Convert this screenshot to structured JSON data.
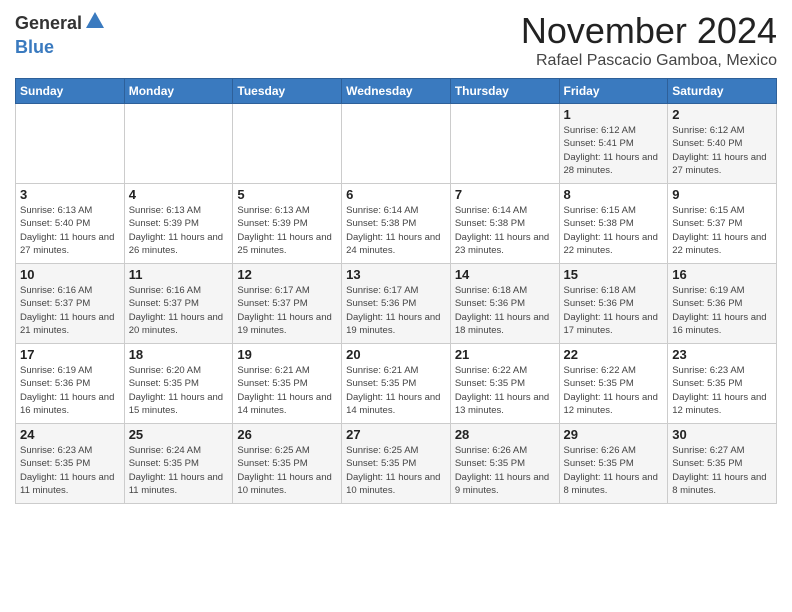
{
  "header": {
    "logo_general": "General",
    "logo_blue": "Blue",
    "month": "November 2024",
    "location": "Rafael Pascacio Gamboa, Mexico"
  },
  "weekdays": [
    "Sunday",
    "Monday",
    "Tuesday",
    "Wednesday",
    "Thursday",
    "Friday",
    "Saturday"
  ],
  "weeks": [
    [
      {
        "day": "",
        "info": ""
      },
      {
        "day": "",
        "info": ""
      },
      {
        "day": "",
        "info": ""
      },
      {
        "day": "",
        "info": ""
      },
      {
        "day": "",
        "info": ""
      },
      {
        "day": "1",
        "info": "Sunrise: 6:12 AM\nSunset: 5:41 PM\nDaylight: 11 hours and 28 minutes."
      },
      {
        "day": "2",
        "info": "Sunrise: 6:12 AM\nSunset: 5:40 PM\nDaylight: 11 hours and 27 minutes."
      }
    ],
    [
      {
        "day": "3",
        "info": "Sunrise: 6:13 AM\nSunset: 5:40 PM\nDaylight: 11 hours and 27 minutes."
      },
      {
        "day": "4",
        "info": "Sunrise: 6:13 AM\nSunset: 5:39 PM\nDaylight: 11 hours and 26 minutes."
      },
      {
        "day": "5",
        "info": "Sunrise: 6:13 AM\nSunset: 5:39 PM\nDaylight: 11 hours and 25 minutes."
      },
      {
        "day": "6",
        "info": "Sunrise: 6:14 AM\nSunset: 5:38 PM\nDaylight: 11 hours and 24 minutes."
      },
      {
        "day": "7",
        "info": "Sunrise: 6:14 AM\nSunset: 5:38 PM\nDaylight: 11 hours and 23 minutes."
      },
      {
        "day": "8",
        "info": "Sunrise: 6:15 AM\nSunset: 5:38 PM\nDaylight: 11 hours and 22 minutes."
      },
      {
        "day": "9",
        "info": "Sunrise: 6:15 AM\nSunset: 5:37 PM\nDaylight: 11 hours and 22 minutes."
      }
    ],
    [
      {
        "day": "10",
        "info": "Sunrise: 6:16 AM\nSunset: 5:37 PM\nDaylight: 11 hours and 21 minutes."
      },
      {
        "day": "11",
        "info": "Sunrise: 6:16 AM\nSunset: 5:37 PM\nDaylight: 11 hours and 20 minutes."
      },
      {
        "day": "12",
        "info": "Sunrise: 6:17 AM\nSunset: 5:37 PM\nDaylight: 11 hours and 19 minutes."
      },
      {
        "day": "13",
        "info": "Sunrise: 6:17 AM\nSunset: 5:36 PM\nDaylight: 11 hours and 19 minutes."
      },
      {
        "day": "14",
        "info": "Sunrise: 6:18 AM\nSunset: 5:36 PM\nDaylight: 11 hours and 18 minutes."
      },
      {
        "day": "15",
        "info": "Sunrise: 6:18 AM\nSunset: 5:36 PM\nDaylight: 11 hours and 17 minutes."
      },
      {
        "day": "16",
        "info": "Sunrise: 6:19 AM\nSunset: 5:36 PM\nDaylight: 11 hours and 16 minutes."
      }
    ],
    [
      {
        "day": "17",
        "info": "Sunrise: 6:19 AM\nSunset: 5:36 PM\nDaylight: 11 hours and 16 minutes."
      },
      {
        "day": "18",
        "info": "Sunrise: 6:20 AM\nSunset: 5:35 PM\nDaylight: 11 hours and 15 minutes."
      },
      {
        "day": "19",
        "info": "Sunrise: 6:21 AM\nSunset: 5:35 PM\nDaylight: 11 hours and 14 minutes."
      },
      {
        "day": "20",
        "info": "Sunrise: 6:21 AM\nSunset: 5:35 PM\nDaylight: 11 hours and 14 minutes."
      },
      {
        "day": "21",
        "info": "Sunrise: 6:22 AM\nSunset: 5:35 PM\nDaylight: 11 hours and 13 minutes."
      },
      {
        "day": "22",
        "info": "Sunrise: 6:22 AM\nSunset: 5:35 PM\nDaylight: 11 hours and 12 minutes."
      },
      {
        "day": "23",
        "info": "Sunrise: 6:23 AM\nSunset: 5:35 PM\nDaylight: 11 hours and 12 minutes."
      }
    ],
    [
      {
        "day": "24",
        "info": "Sunrise: 6:23 AM\nSunset: 5:35 PM\nDaylight: 11 hours and 11 minutes."
      },
      {
        "day": "25",
        "info": "Sunrise: 6:24 AM\nSunset: 5:35 PM\nDaylight: 11 hours and 11 minutes."
      },
      {
        "day": "26",
        "info": "Sunrise: 6:25 AM\nSunset: 5:35 PM\nDaylight: 11 hours and 10 minutes."
      },
      {
        "day": "27",
        "info": "Sunrise: 6:25 AM\nSunset: 5:35 PM\nDaylight: 11 hours and 10 minutes."
      },
      {
        "day": "28",
        "info": "Sunrise: 6:26 AM\nSunset: 5:35 PM\nDaylight: 11 hours and 9 minutes."
      },
      {
        "day": "29",
        "info": "Sunrise: 6:26 AM\nSunset: 5:35 PM\nDaylight: 11 hours and 8 minutes."
      },
      {
        "day": "30",
        "info": "Sunrise: 6:27 AM\nSunset: 5:35 PM\nDaylight: 11 hours and 8 minutes."
      }
    ]
  ]
}
